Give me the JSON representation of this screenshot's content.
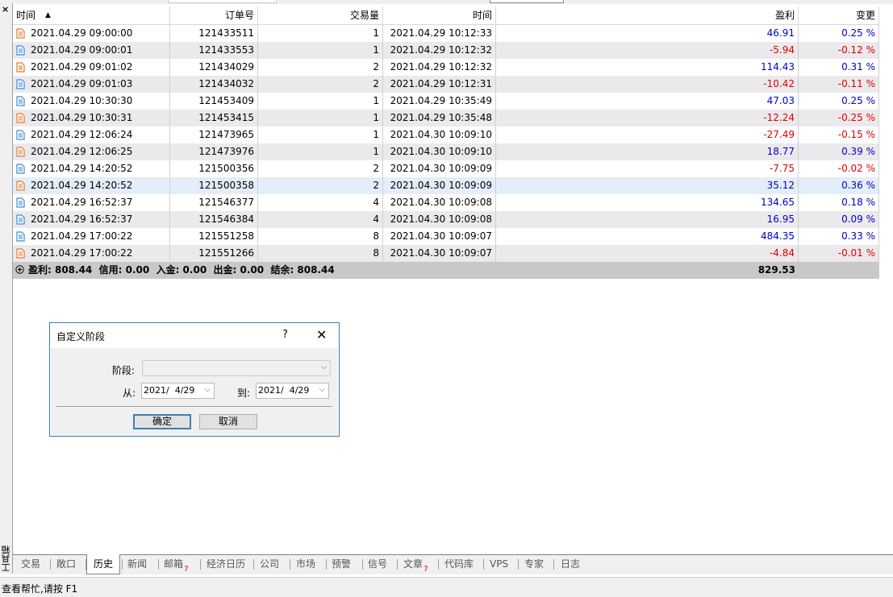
{
  "sidebar": {
    "close": "×",
    "vertical_label": "工具箱"
  },
  "columns": {
    "time": "时间",
    "order": "订单号",
    "volume": "交易量",
    "close_time": "时间",
    "profit": "盈利",
    "change": "变更",
    "sort_indicator": "▲"
  },
  "rows": [
    {
      "icon": "orange",
      "time": "2021.04.29 09:00:00",
      "order": "121433511",
      "volume": "1",
      "close_time": "2021.04.29 10:12:33",
      "profit": "46.91",
      "change": "0.25 %",
      "sign": "pos"
    },
    {
      "icon": "blue",
      "time": "2021.04.29 09:00:01",
      "order": "121433553",
      "volume": "1",
      "close_time": "2021.04.29 10:12:32",
      "profit": "-5.94",
      "change": "-0.12 %",
      "sign": "neg"
    },
    {
      "icon": "orange",
      "time": "2021.04.29 09:01:02",
      "order": "121434029",
      "volume": "2",
      "close_time": "2021.04.29 10:12:32",
      "profit": "114.43",
      "change": "0.31 %",
      "sign": "pos"
    },
    {
      "icon": "blue",
      "time": "2021.04.29 09:01:03",
      "order": "121434032",
      "volume": "2",
      "close_time": "2021.04.29 10:12:31",
      "profit": "-10.42",
      "change": "-0.11 %",
      "sign": "neg"
    },
    {
      "icon": "blue",
      "time": "2021.04.29 10:30:30",
      "order": "121453409",
      "volume": "1",
      "close_time": "2021.04.29 10:35:49",
      "profit": "47.03",
      "change": "0.25 %",
      "sign": "pos"
    },
    {
      "icon": "orange",
      "time": "2021.04.29 10:30:31",
      "order": "121453415",
      "volume": "1",
      "close_time": "2021.04.29 10:35:48",
      "profit": "-12.24",
      "change": "-0.25 %",
      "sign": "neg"
    },
    {
      "icon": "blue",
      "time": "2021.04.29 12:06:24",
      "order": "121473965",
      "volume": "1",
      "close_time": "2021.04.30 10:09:10",
      "profit": "-27.49",
      "change": "-0.15 %",
      "sign": "neg"
    },
    {
      "icon": "orange",
      "time": "2021.04.29 12:06:25",
      "order": "121473976",
      "volume": "1",
      "close_time": "2021.04.30 10:09:10",
      "profit": "18.77",
      "change": "0.39 %",
      "sign": "pos"
    },
    {
      "icon": "blue",
      "time": "2021.04.29 14:20:52",
      "order": "121500356",
      "volume": "2",
      "close_time": "2021.04.30 10:09:09",
      "profit": "-7.75",
      "change": "-0.02 %",
      "sign": "neg"
    },
    {
      "icon": "orange",
      "time": "2021.04.29 14:20:52",
      "order": "121500358",
      "volume": "2",
      "close_time": "2021.04.30 10:09:09",
      "profit": "35.12",
      "change": "0.36 %",
      "sign": "pos",
      "selected": true
    },
    {
      "icon": "blue",
      "time": "2021.04.29 16:52:37",
      "order": "121546377",
      "volume": "4",
      "close_time": "2021.04.30 10:09:08",
      "profit": "134.65",
      "change": "0.18 %",
      "sign": "pos"
    },
    {
      "icon": "blue",
      "time": "2021.04.29 16:52:37",
      "order": "121546384",
      "volume": "4",
      "close_time": "2021.04.30 10:09:08",
      "profit": "16.95",
      "change": "0.09 %",
      "sign": "pos"
    },
    {
      "icon": "blue",
      "time": "2021.04.29 17:00:22",
      "order": "121551258",
      "volume": "8",
      "close_time": "2021.04.30 10:09:07",
      "profit": "484.35",
      "change": "0.33 %",
      "sign": "pos"
    },
    {
      "icon": "orange",
      "time": "2021.04.29 17:00:22",
      "order": "121551266",
      "volume": "8",
      "close_time": "2021.04.30 10:09:07",
      "profit": "-4.84",
      "change": "-0.01 %",
      "sign": "neg"
    }
  ],
  "summary": {
    "text": "盈利: 808.44  信用: 0.00  入金: 0.00  出金: 0.00  结余: 808.44",
    "total": "829.53"
  },
  "dialog": {
    "title": "自定义阶段",
    "help": "?",
    "close": "✕",
    "period_label": "阶段:",
    "period_value": "",
    "from_label": "从:",
    "from_value": "2021/  4/29",
    "to_label": "到:",
    "to_value": "2021/  4/29",
    "ok": "确定",
    "cancel": "取消"
  },
  "tabs": [
    {
      "label": "交易"
    },
    {
      "label": "敞口"
    },
    {
      "label": "历史",
      "active": true
    },
    {
      "label": "新闻"
    },
    {
      "label": "邮箱",
      "badge": "7"
    },
    {
      "label": "经济日历"
    },
    {
      "label": "公司"
    },
    {
      "label": "市场"
    },
    {
      "label": "预警"
    },
    {
      "label": "信号"
    },
    {
      "label": "文章",
      "badge": "7"
    },
    {
      "label": "代码库"
    },
    {
      "label": "VPS"
    },
    {
      "label": "专家"
    },
    {
      "label": "日志"
    }
  ],
  "status": {
    "text": "查看帮忙,请按 F1"
  },
  "colors": {
    "positive": "#0000c8",
    "negative": "#e00000",
    "icon_blue": "#3c8ad8",
    "icon_orange": "#e8742c",
    "dialog_border": "#3c7fb1"
  }
}
